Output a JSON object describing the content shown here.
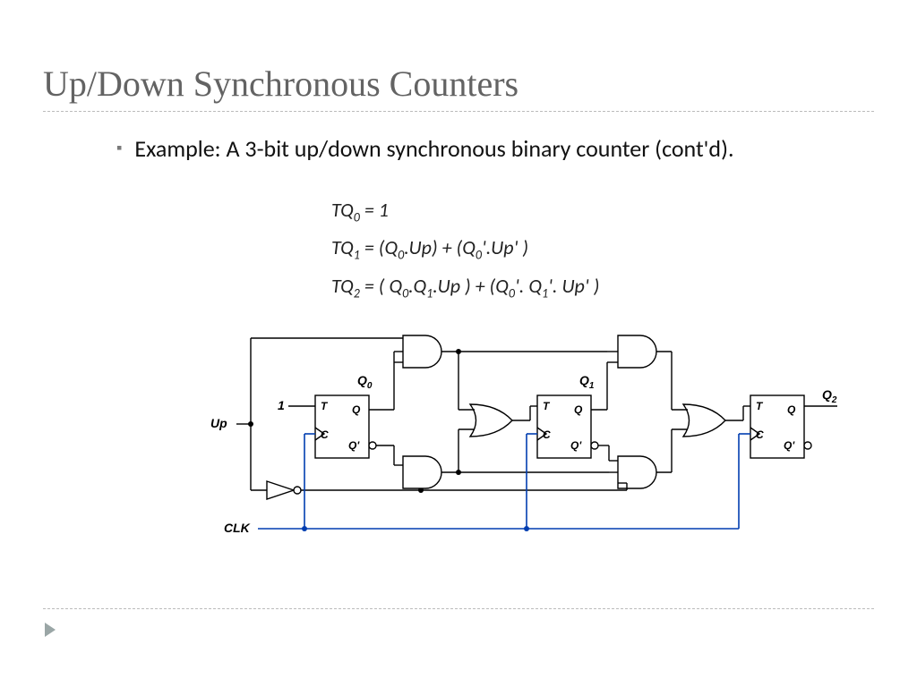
{
  "title": "Up/Down Synchronous Counters",
  "bullet_text": "Example: A 3-bit up/down synchronous binary counter (cont'd).",
  "equations": {
    "tq0": "TQ",
    "tq0_sub": "0",
    "tq0_rhs": " = 1",
    "tq1": "TQ",
    "tq1_sub": "1",
    "tq1_rhs_a": " = (Q",
    "tq1_rhs_b": ".Up) + (Q",
    "tq1_rhs_c": "'.Up' )",
    "tq2": "TQ",
    "tq2_sub": "2",
    "tq2_rhs_a": " = ( Q",
    "tq2_rhs_b": ".Q",
    "tq2_rhs_c": ".Up ) + (Q",
    "tq2_rhs_d": "'. Q",
    "tq2_rhs_e": "'. Up' )"
  },
  "labels": {
    "up": "Up",
    "clk": "CLK",
    "one": "1",
    "q0": "Q",
    "q0s": "0",
    "q1": "Q",
    "q1s": "1",
    "q2": "Q",
    "q2s": "2",
    "T": "T",
    "C": "C",
    "Q": "Q",
    "Qp": "Q'"
  }
}
